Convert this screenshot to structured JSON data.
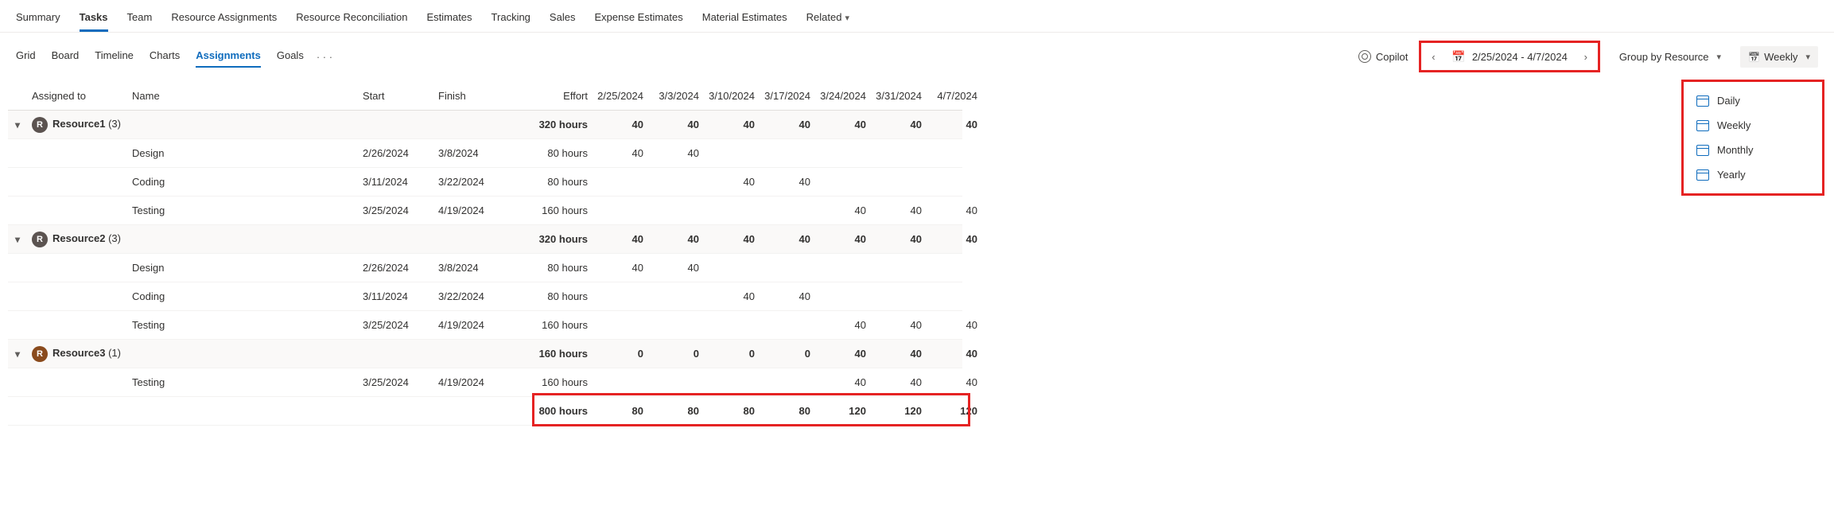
{
  "topTabs": [
    "Summary",
    "Tasks",
    "Team",
    "Resource Assignments",
    "Resource Reconciliation",
    "Estimates",
    "Tracking",
    "Sales",
    "Expense Estimates",
    "Material Estimates",
    "Related"
  ],
  "topTabActive": "Tasks",
  "viewTabs": [
    "Grid",
    "Board",
    "Timeline",
    "Charts",
    "Assignments",
    "Goals"
  ],
  "viewTabActive": "Assignments",
  "copilotLabel": "Copilot",
  "dateRange": "2/25/2024 - 4/7/2024",
  "groupBy": "Group by Resource",
  "timescale": "Weekly",
  "timescaleOptions": [
    "Daily",
    "Weekly",
    "Monthly",
    "Yearly"
  ],
  "columns": {
    "assignedTo": "Assigned to",
    "name": "Name",
    "start": "Start",
    "finish": "Finish",
    "effort": "Effort"
  },
  "dateCols": [
    "2/25/2024",
    "3/3/2024",
    "3/10/2024",
    "3/17/2024",
    "3/24/2024",
    "3/31/2024",
    "4/7/2024"
  ],
  "groups": [
    {
      "label": "Resource1",
      "count": "(3)",
      "effort": "320 hours",
      "cells": [
        "40",
        "40",
        "40",
        "40",
        "40",
        "40",
        "40"
      ],
      "avatar": "R",
      "avatarClass": "",
      "tasks": [
        {
          "name": "Design",
          "start": "2/26/2024",
          "finish": "3/8/2024",
          "effort": "80 hours",
          "cells": [
            "40",
            "40",
            "",
            "",
            "",
            "",
            ""
          ]
        },
        {
          "name": "Coding",
          "start": "3/11/2024",
          "finish": "3/22/2024",
          "effort": "80 hours",
          "cells": [
            "",
            "",
            "40",
            "40",
            "",
            "",
            ""
          ]
        },
        {
          "name": "Testing",
          "start": "3/25/2024",
          "finish": "4/19/2024",
          "effort": "160 hours",
          "cells": [
            "",
            "",
            "",
            "",
            "40",
            "40",
            "40"
          ]
        }
      ]
    },
    {
      "label": "Resource2",
      "count": "(3)",
      "effort": "320 hours",
      "cells": [
        "40",
        "40",
        "40",
        "40",
        "40",
        "40",
        "40"
      ],
      "avatar": "R",
      "avatarClass": "",
      "tasks": [
        {
          "name": "Design",
          "start": "2/26/2024",
          "finish": "3/8/2024",
          "effort": "80 hours",
          "cells": [
            "40",
            "40",
            "",
            "",
            "",
            "",
            ""
          ]
        },
        {
          "name": "Coding",
          "start": "3/11/2024",
          "finish": "3/22/2024",
          "effort": "80 hours",
          "cells": [
            "",
            "",
            "40",
            "40",
            "",
            "",
            ""
          ]
        },
        {
          "name": "Testing",
          "start": "3/25/2024",
          "finish": "4/19/2024",
          "effort": "160 hours",
          "cells": [
            "",
            "",
            "",
            "",
            "40",
            "40",
            "40"
          ]
        }
      ]
    },
    {
      "label": "Resource3",
      "count": "(1)",
      "effort": "160 hours",
      "cells": [
        "0",
        "0",
        "0",
        "0",
        "40",
        "40",
        "40"
      ],
      "avatar": "R",
      "avatarClass": "r3",
      "tasks": [
        {
          "name": "Testing",
          "start": "3/25/2024",
          "finish": "4/19/2024",
          "effort": "160 hours",
          "cells": [
            "",
            "",
            "",
            "",
            "40",
            "40",
            "40"
          ]
        }
      ]
    }
  ],
  "total": {
    "effort": "800 hours",
    "cells": [
      "80",
      "80",
      "80",
      "80",
      "120",
      "120",
      "120"
    ]
  }
}
